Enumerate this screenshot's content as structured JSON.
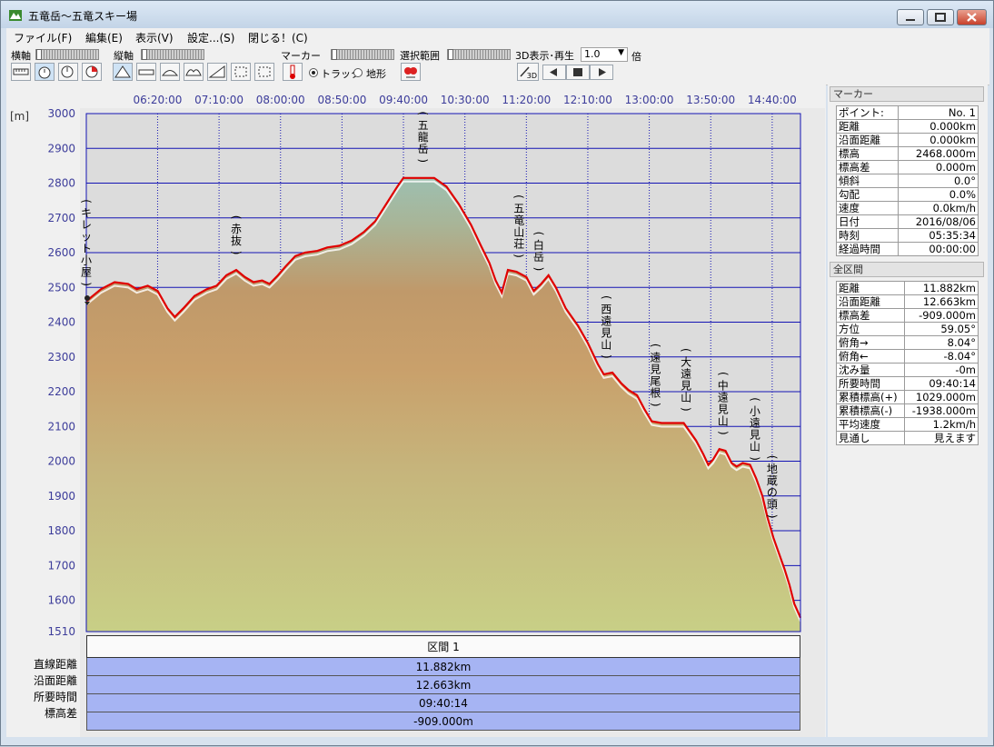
{
  "window": {
    "title": "五竜岳～五竜スキー場"
  },
  "menu": [
    "ファイル(F)",
    "編集(E)",
    "表示(V)",
    "設定...(S)",
    "閉じる！(C)"
  ],
  "toolbar": {
    "h_axis_label": "横軸",
    "v_axis_label": "縦軸",
    "marker_label": "マーカー",
    "selection_label": "選択範囲",
    "playback_label": "3D表示･再生",
    "speed_value": "1.0",
    "speed_unit": "倍",
    "track_option": "トラック",
    "terrain_option": "地形",
    "btn_3d": "3D"
  },
  "chart": {
    "y_unit": "[m]",
    "x_tick_labels": [
      "06:20:00",
      "07:10:00",
      "08:00:00",
      "08:50:00",
      "09:40:00",
      "10:30:00",
      "11:20:00",
      "12:10:00",
      "13:00:00",
      "13:50:00",
      "14:40:00"
    ],
    "y_tick_labels": [
      "3000",
      "2900",
      "2800",
      "2700",
      "2600",
      "2500",
      "2400",
      "2300",
      "2200",
      "2100",
      "2000",
      "1900",
      "1800",
      "1700",
      "1600",
      "1510"
    ],
    "y_min": 1510,
    "y_max": 3000,
    "x_range_minutes": [
      322,
      903
    ],
    "track_color": "#e00000",
    "grid_color": "#1414b4",
    "profile": [
      [
        322,
        2460
      ],
      [
        327,
        2475
      ],
      [
        334,
        2495
      ],
      [
        345,
        2515
      ],
      [
        356,
        2510
      ],
      [
        363,
        2495
      ],
      [
        372,
        2505
      ],
      [
        380,
        2490
      ],
      [
        388,
        2440
      ],
      [
        394,
        2415
      ],
      [
        401,
        2440
      ],
      [
        410,
        2475
      ],
      [
        420,
        2495
      ],
      [
        428,
        2505
      ],
      [
        436,
        2535
      ],
      [
        444,
        2550
      ],
      [
        451,
        2530
      ],
      [
        458,
        2515
      ],
      [
        465,
        2520
      ],
      [
        471,
        2510
      ],
      [
        478,
        2535
      ],
      [
        484,
        2560
      ],
      [
        492,
        2590
      ],
      [
        500,
        2600
      ],
      [
        510,
        2605
      ],
      [
        518,
        2615
      ],
      [
        528,
        2620
      ],
      [
        538,
        2635
      ],
      [
        548,
        2660
      ],
      [
        557,
        2690
      ],
      [
        566,
        2740
      ],
      [
        575,
        2790
      ],
      [
        580,
        2815
      ],
      [
        590,
        2815
      ],
      [
        605,
        2815
      ],
      [
        615,
        2790
      ],
      [
        625,
        2740
      ],
      [
        635,
        2680
      ],
      [
        643,
        2620
      ],
      [
        650,
        2570
      ],
      [
        655,
        2520
      ],
      [
        660,
        2485
      ],
      [
        665,
        2550
      ],
      [
        672,
        2545
      ],
      [
        680,
        2530
      ],
      [
        686,
        2490
      ],
      [
        692,
        2510
      ],
      [
        698,
        2535
      ],
      [
        704,
        2500
      ],
      [
        712,
        2440
      ],
      [
        722,
        2390
      ],
      [
        730,
        2340
      ],
      [
        738,
        2280
      ],
      [
        743,
        2250
      ],
      [
        750,
        2255
      ],
      [
        757,
        2225
      ],
      [
        763,
        2205
      ],
      [
        770,
        2190
      ],
      [
        776,
        2150
      ],
      [
        782,
        2115
      ],
      [
        790,
        2110
      ],
      [
        800,
        2110
      ],
      [
        808,
        2110
      ],
      [
        812,
        2090
      ],
      [
        818,
        2060
      ],
      [
        824,
        2020
      ],
      [
        828,
        1990
      ],
      [
        832,
        2005
      ],
      [
        837,
        2035
      ],
      [
        842,
        2030
      ],
      [
        847,
        1995
      ],
      [
        851,
        1985
      ],
      [
        856,
        1995
      ],
      [
        862,
        1990
      ],
      [
        867,
        1950
      ],
      [
        872,
        1900
      ],
      [
        876,
        1840
      ],
      [
        881,
        1780
      ],
      [
        885,
        1740
      ],
      [
        890,
        1690
      ],
      [
        894,
        1645
      ],
      [
        898,
        1590
      ],
      [
        903,
        1550
      ]
    ],
    "annotations": [
      {
        "label": "(キレット小屋)",
        "t": 322
      },
      {
        "label": "(赤抜)",
        "t": 444
      },
      {
        "label": "(五龍岳)",
        "t": 596
      },
      {
        "label": "(五竜山荘)",
        "t": 674
      },
      {
        "label": "(白岳)",
        "t": 690
      },
      {
        "label": "(西遠見山)",
        "t": 745
      },
      {
        "label": "(遠見尾根)",
        "t": 785
      },
      {
        "label": "(大遠見山)",
        "t": 810
      },
      {
        "label": "(中遠見山)",
        "t": 840
      },
      {
        "label": "(小遠見山)",
        "t": 866
      },
      {
        "label": "(地蔵の頭)",
        "t": 880
      }
    ]
  },
  "sections": {
    "header": "区間 1",
    "rows": [
      {
        "label": "直線距離",
        "value": "11.882km"
      },
      {
        "label": "沿面距離",
        "value": "12.663km"
      },
      {
        "label": "所要時間",
        "value": "09:40:14"
      },
      {
        "label": "標高差",
        "value": "-909.000m"
      }
    ]
  },
  "marker_panel": {
    "title": "マーカー",
    "rows": [
      {
        "label": "ポイント:",
        "value": "No. 1"
      },
      {
        "label": "距離",
        "value": "0.000km"
      },
      {
        "label": "沿面距離",
        "value": "0.000km"
      },
      {
        "label": "標高",
        "value": "2468.000m"
      },
      {
        "label": "標高差",
        "value": "0.000m"
      },
      {
        "label": "傾斜",
        "value": "0.0°"
      },
      {
        "label": "勾配",
        "value": "0.0%"
      },
      {
        "label": "速度",
        "value": "0.0km/h"
      },
      {
        "label": "日付",
        "value": "2016/08/06"
      },
      {
        "label": "時刻",
        "value": "05:35:34"
      },
      {
        "label": "経過時間",
        "value": "00:00:00"
      }
    ]
  },
  "total_panel": {
    "title": "全区間",
    "rows": [
      {
        "label": "距離",
        "value": "11.882km"
      },
      {
        "label": "沿面距離",
        "value": "12.663km"
      },
      {
        "label": "標高差",
        "value": "-909.000m"
      },
      {
        "label": "方位",
        "value": "59.05°"
      },
      {
        "label": "俯角→",
        "value": "8.04°"
      },
      {
        "label": "俯角←",
        "value": "-8.04°"
      },
      {
        "label": "沈み量",
        "value": "-0m"
      },
      {
        "label": "所要時間",
        "value": "09:40:14"
      },
      {
        "label": "累積標高(+)",
        "value": "1029.000m"
      },
      {
        "label": "累積標高(-)",
        "value": "-1938.000m"
      },
      {
        "label": "平均速度",
        "value": "1.2km/h"
      },
      {
        "label": "見通し",
        "value": "見えます"
      }
    ]
  }
}
